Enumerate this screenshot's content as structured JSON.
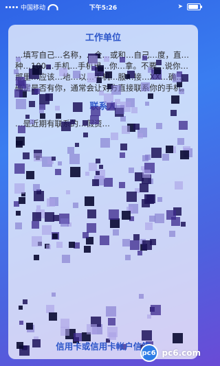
{
  "status_bar": {
    "carrier": "中国移动",
    "time": "下午5:26",
    "wifi_icon": "wifi-icon",
    "battery_icon": "battery-icon"
  },
  "card": {
    "section1_title": "工作单位",
    "section1_paragraph": "…填写自己…名称，…企…或和…自己…度，直…种…100…手机…手机里…你…拿。不要…说你…那里…应该…地…以…手机…服…接…XX…确…确定是否有你，通常会让对方直接联系你的手机。",
    "section2_title": "联系人",
    "section2_paragraph": "…是近期有联系的…假资…",
    "footer_link": "信用卡或信用卡帐户信箱"
  },
  "watermark": {
    "text": "pc6.com",
    "badge": "pc6"
  }
}
